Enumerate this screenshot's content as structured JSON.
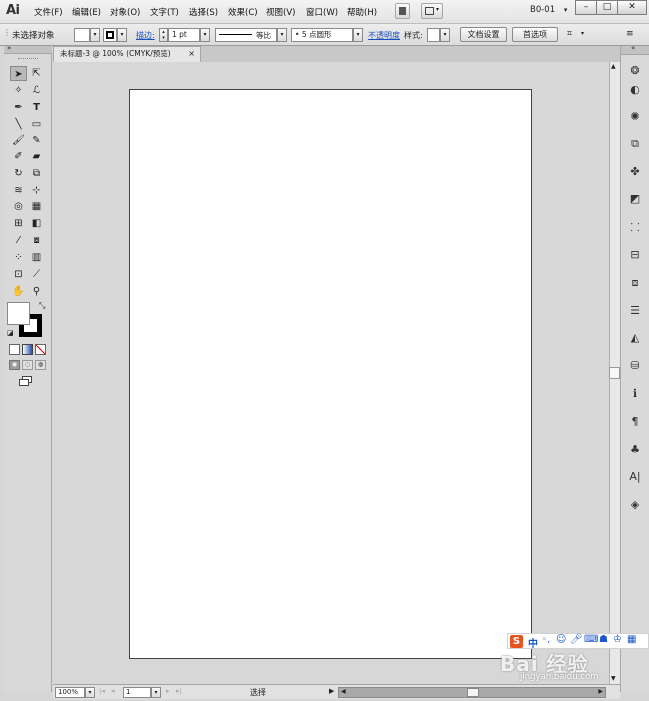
{
  "app": {
    "logo": "Ai",
    "workspace": "B0-01"
  },
  "menus": [
    "文件(F)",
    "编辑(E)",
    "对象(O)",
    "文字(T)",
    "选择(S)",
    "效果(C)",
    "视图(V)",
    "窗口(W)",
    "帮助(H)"
  ],
  "window_controls": {
    "minimize": "–",
    "maximize": "□",
    "close": "✕"
  },
  "control_bar": {
    "selection_status": "未选择对象",
    "stroke_label": "描边:",
    "stroke_weight": "1 pt",
    "stroke_profile": "等比",
    "brush": "5 点圆形",
    "opacity_label": "不透明度",
    "style_label": "样式:",
    "doc_setup_button": "文档设置",
    "preferences_button": "首选项"
  },
  "document": {
    "tab_title": "未标题-3 @ 100% (CMYK/预览)",
    "tab_close": "×"
  },
  "status_bar": {
    "zoom": "100%",
    "page": "1",
    "tool_status": "选择"
  },
  "overlay": {
    "ime_logo": "S",
    "ime_label": "中",
    "watermark": "Bai 经验",
    "watermark_url": "jingyan.baidu.com"
  },
  "icons": {
    "tools": [
      "selection-arrow-icon",
      "direct-selection-icon",
      "magic-wand-icon",
      "lasso-icon",
      "pen-icon",
      "type-icon",
      "line-segment-icon",
      "rectangle-icon",
      "paintbrush-icon",
      "pencil-icon",
      "blob-brush-icon",
      "eraser-icon",
      "rotate-icon",
      "scale-icon",
      "warp-icon",
      "free-transform-icon",
      "shape-builder-icon",
      "perspective-grid-icon",
      "mesh-icon",
      "gradient-icon",
      "eyedropper-icon",
      "blend-icon",
      "symbol-sprayer-icon",
      "column-graph-icon",
      "artboard-icon",
      "slice-icon",
      "hand-icon",
      "zoom-icon"
    ],
    "dock": [
      "color-panel-icon",
      "color-guide-icon",
      "swatches-icon",
      "brushes-icon",
      "symbols-icon",
      "graphic-styles-icon",
      "appearance-icon",
      "align-icon",
      "transform-icon",
      "pathfinder-icon",
      "stroke-icon",
      "gradient-panel-icon",
      "transparency-icon",
      "links-icon",
      "paragraph-icon",
      "character-styles-icon",
      "character-icon",
      "layers-icon"
    ]
  },
  "colors": {
    "fill": "#ffffff",
    "stroke": "#000000",
    "ime_accent": "#e9531e"
  }
}
